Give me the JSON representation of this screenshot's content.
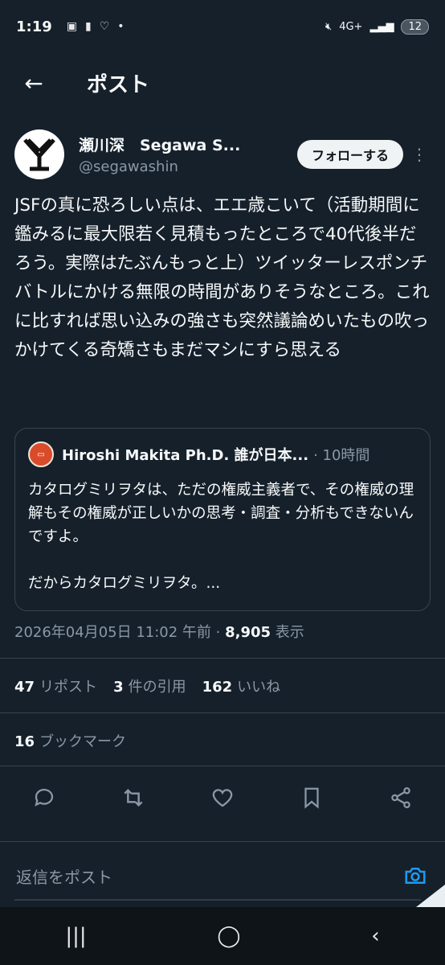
{
  "status_bar": {
    "time": "1:19",
    "network": "4G+",
    "battery": "12",
    "dot": "•"
  },
  "header": {
    "back_icon": "←",
    "title": "ポスト"
  },
  "author": {
    "avatar_text": "Y",
    "display_name": "瀬川深　Segawa S...",
    "handle": "@segawashin",
    "follow_label": "フォローする",
    "more_icon": "⋮"
  },
  "tweet": {
    "text": "JSFの真に恐ろしい点は、エエ歳こいて（活動期間に鑑みるに最大限若く見積もったところで40代後半だろう。実際はたぶんもっと上）ツイッターレスポンチバトルにかける無限の時間がありそうなところ。これに比すれば思い込みの強さも突然議論めいたもの吹っかけてくる奇矯さもまだマシにすら思える"
  },
  "quote": {
    "author_name": "Hiroshi Makita Ph.D. 誰が日本...",
    "time": "· 10時間",
    "text": "カタログミリヲタは、ただの権威主義者で、その権威の理解もその権威が正しいかの思考・調査・分析もできないんですよ。\n\nだからカタログミリヲタ。..."
  },
  "meta": {
    "datetime": "2026年04月05日 11:02 午前 · ",
    "views": "8,905",
    "views_label": " 表示"
  },
  "stats": {
    "reposts_count": "47",
    "reposts_label": "リポスト",
    "quotes_count": "3",
    "quotes_label": "件の引用",
    "likes_count": "162",
    "likes_label": "いいね",
    "bookmarks_count": "16",
    "bookmarks_label": "ブックマーク"
  },
  "reply": {
    "placeholder": "返信をポスト"
  },
  "nav": {
    "recents": "|||",
    "home": "◯",
    "back": "‹"
  }
}
